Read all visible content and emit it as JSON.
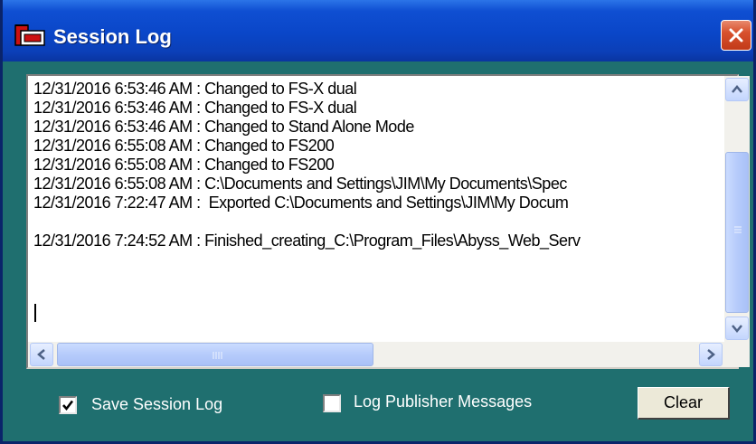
{
  "window": {
    "title": "Session Log",
    "icon": "session-log-app-icon",
    "close_icon": "close-icon",
    "colors": {
      "titlebar": "#0a46c8",
      "body": "#1f6f6f",
      "close": "#d8522e"
    }
  },
  "log": {
    "lines": [
      "12/31/2016 6:53:46 AM : Changed to FS-X dual",
      "12/31/2016 6:53:46 AM : Changed to FS-X dual",
      "12/31/2016 6:53:46 AM : Changed to Stand Alone Mode",
      "12/31/2016 6:55:08 AM : Changed to FS200",
      "12/31/2016 6:55:08 AM : Changed to FS200",
      "12/31/2016 6:55:08 AM : C:\\Documents and Settings\\JIM\\My Documents\\Spec",
      "12/31/2016 7:22:47 AM :  Exported C:\\Documents and Settings\\JIM\\My Docum",
      "",
      "12/31/2016 7:24:52 AM : Finished_creating_C:\\Program_Files\\Abyss_Web_Serv"
    ]
  },
  "controls": {
    "save_session_log": {
      "label": "Save Session Log",
      "checked": true
    },
    "log_publisher_messages": {
      "label": "Log Publisher Messages",
      "checked": false
    },
    "clear_label": "Clear"
  }
}
